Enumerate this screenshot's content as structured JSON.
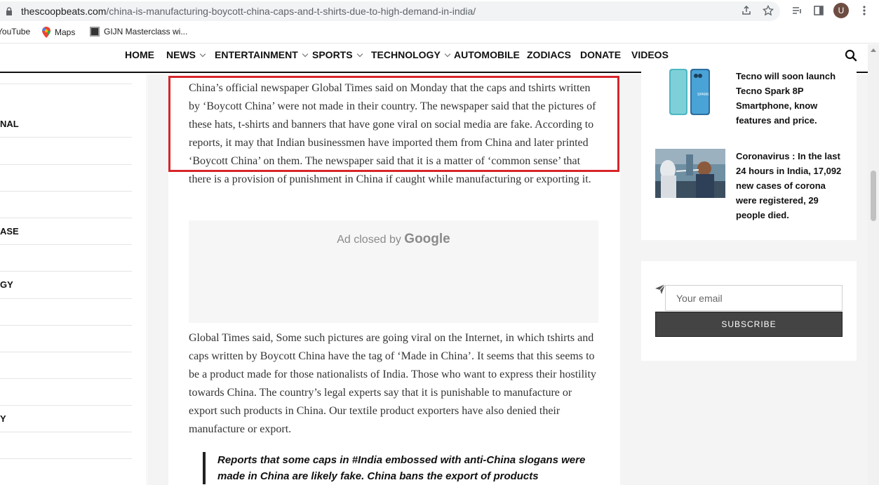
{
  "browser": {
    "url_host": "thescoopbeats.com",
    "url_path": "/china-is-manufacturing-boycott-china-caps-and-t-shirts-due-to-high-demand-in-india/",
    "avatar_letter": "U",
    "bookmarks": [
      "YouTube",
      "Maps",
      "GIJN Masterclass wi..."
    ]
  },
  "nav": {
    "items": [
      {
        "label": "HOME"
      },
      {
        "label": "NEWS"
      },
      {
        "label": "ENTERTAINMENT"
      },
      {
        "label": "SPORTS"
      },
      {
        "label": "TECHNOLOGY"
      },
      {
        "label": "AUTOMOBILE"
      },
      {
        "label": "ZODIACS"
      },
      {
        "label": "DONATE"
      },
      {
        "label": "VIDEOS"
      }
    ]
  },
  "left_sidebar": {
    "labels": [
      "NAL",
      "ASE",
      "GY",
      "Y"
    ]
  },
  "article": {
    "para1": "China’s official newspaper Global Times said on Monday that the caps and tshirts written by ‘Boycott China’ were not made in their country. The newspaper said that the pictures of these hats, t-shirts and banners that have gone viral on social media are fake. According to reports, it may that Indian businessmen have imported them from China and later printed ‘Boycott China’ on them. The newspaper said that it is a matter of ‘common sense’ that there is a provision of punishment in China if caught while manufacturing or exporting it.",
    "ad_text": "Ad closed by",
    "ad_brand": "Google",
    "para2": "Global Times said, Some such pictures are going viral on the Internet, in which tshirts and caps written by Boycott China have the tag of ‘Made in China’. It seems that this seems to be a product made for those nationalists of India. Those who want to express their hostility towards China. The country’s legal experts say that it is punishable to manufacture or export such products in China. Our textile product exporters have also denied their manufacture or export.",
    "quote": "Reports that some caps in #India embossed with anti-China slogans were made in China are likely fake. China bans the export of products"
  },
  "right_sidebar": {
    "news": [
      {
        "title": "Tecno will soon launch Tecno Spark 8P Smartphone, know features and price.",
        "thumb_label": "SPARK 8P"
      },
      {
        "title": "Coronavirus : In the last 24 hours in India, 17,092 new cases of corona were registered, 29 people died."
      }
    ],
    "subscribe": {
      "email_placeholder": "Your email",
      "button_label": "SUBSCRIBE"
    }
  }
}
